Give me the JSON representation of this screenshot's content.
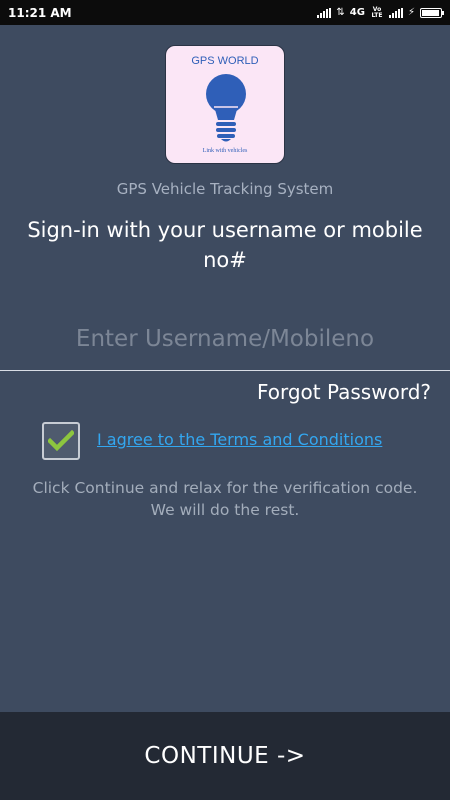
{
  "status_bar": {
    "time": "11:21 AM",
    "network": "4G",
    "volte": "Vo LTE",
    "battery_level": 0.95
  },
  "logo": {
    "title": "GPS WORLD",
    "tagline": "Link with vehicles"
  },
  "app_subtitle": "GPS Vehicle Tracking System",
  "heading": "Sign-in with your username or mobile no#",
  "username_input": {
    "placeholder": "Enter Username/Mobileno",
    "value": ""
  },
  "forgot_password_label": "Forgot Password?",
  "terms": {
    "checked": true,
    "label": "I agree to the Terms and Conditions"
  },
  "info_text": "Click Continue and relax for the verification code. We will do the rest.",
  "continue_label": "CONTINUE ->",
  "colors": {
    "background": "#3e4b60",
    "continue_bar": "#232934",
    "link": "#33a7f0",
    "check": "#8dc63f",
    "logo_bg": "#fbe6f6",
    "logo_blue": "#2f5fb8"
  }
}
